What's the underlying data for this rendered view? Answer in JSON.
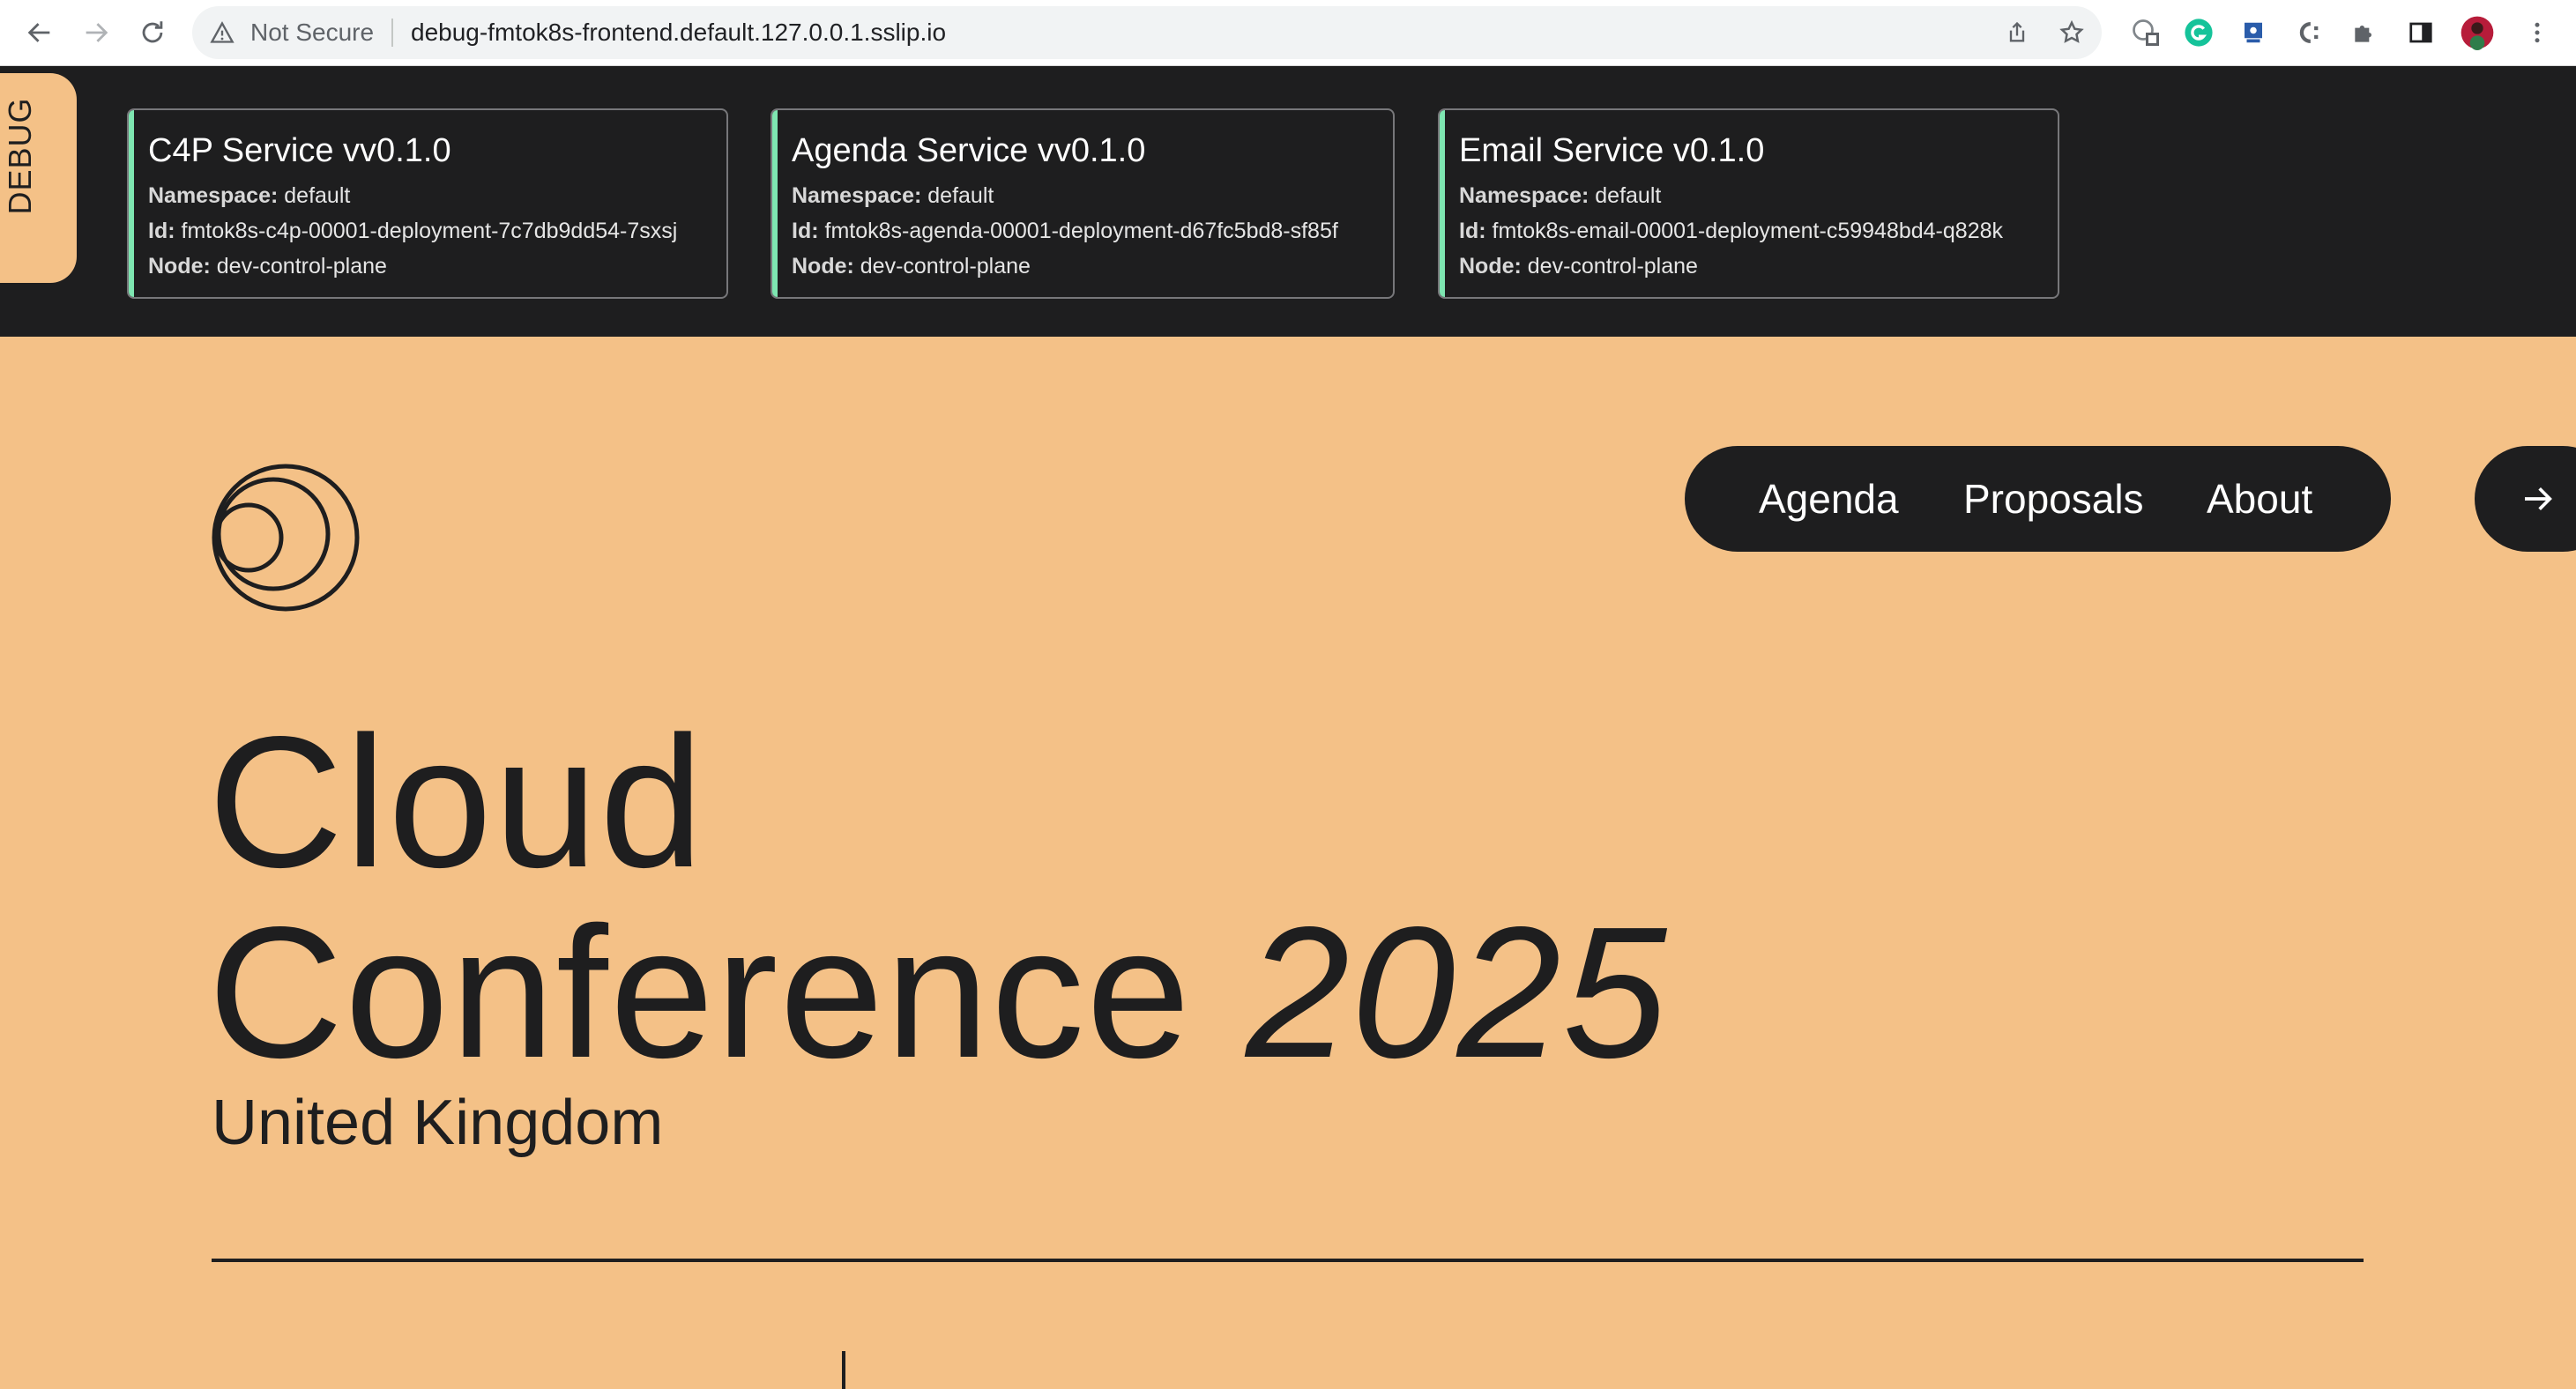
{
  "browser": {
    "security_label": "Not Secure",
    "url": "debug-fmtok8s-frontend.default.127.0.0.1.sslip.io",
    "icons": [
      "back-icon",
      "forward-icon",
      "reload-icon",
      "warning-icon",
      "share-icon",
      "star-icon",
      "translate-icon",
      "grammarly-icon",
      "extension-icon",
      "extension-icon",
      "puzzle-icon",
      "sidebar-icon",
      "avatar",
      "more-icon"
    ]
  },
  "debug": {
    "tab_label": "DEBUG",
    "services": [
      {
        "title": "C4P Service vv0.1.0",
        "namespace_label": "Namespace:",
        "namespace": " default",
        "id_label": "Id:",
        "id": " fmtok8s-c4p-00001-deployment-7c7db9dd54-7sxsj",
        "node_label": "Node:",
        "node": " dev-control-plane"
      },
      {
        "title": "Agenda Service vv0.1.0",
        "namespace_label": "Namespace:",
        "namespace": " default",
        "id_label": "Id:",
        "id": " fmtok8s-agenda-00001-deployment-d67fc5bd8-sf85f",
        "node_label": "Node:",
        "node": " dev-control-plane"
      },
      {
        "title": "Email Service v0.1.0",
        "namespace_label": "Namespace:",
        "namespace": " default",
        "id_label": "Id:",
        "id": " fmtok8s-email-00001-deployment-c59948bd4-q828k",
        "node_label": "Node:",
        "node": " dev-control-plane"
      }
    ],
    "accent_color": "#7ee6b1"
  },
  "nav": {
    "items": [
      "Agenda",
      "Proposals",
      "About"
    ]
  },
  "hero": {
    "line1": "Cloud",
    "line2_text": "Conference ",
    "line2_year": "2025",
    "subtitle": "United Kingdom"
  },
  "colors": {
    "background": "#f4c187",
    "dark": "#1e1e1f"
  }
}
